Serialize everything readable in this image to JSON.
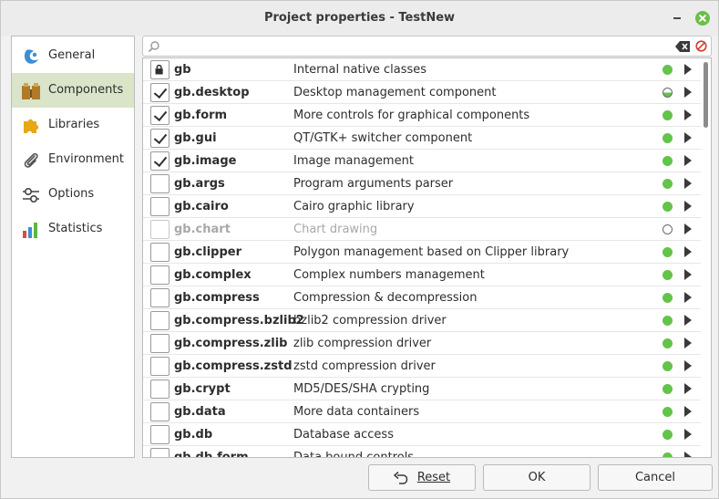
{
  "window": {
    "title": "Project properties - TestNew"
  },
  "sidebar": {
    "items": [
      {
        "label": "General",
        "icon": "gambas-icon",
        "active": false
      },
      {
        "label": "Components",
        "icon": "components-icon",
        "active": true
      },
      {
        "label": "Libraries",
        "icon": "puzzle-icon",
        "active": false
      },
      {
        "label": "Environment",
        "icon": "paperclip-icon",
        "active": false
      },
      {
        "label": "Options",
        "icon": "toggle-icon",
        "active": false
      },
      {
        "label": "Statistics",
        "icon": "bar-chart-icon",
        "active": false
      }
    ]
  },
  "search": {
    "value": "",
    "placeholder": ""
  },
  "components": [
    {
      "name": "gb",
      "description": "Internal native classes",
      "state": "locked",
      "status": "stable"
    },
    {
      "name": "gb.desktop",
      "description": "Desktop management component",
      "state": "checked",
      "status": "half"
    },
    {
      "name": "gb.form",
      "description": "More controls for graphical components",
      "state": "checked",
      "status": "stable"
    },
    {
      "name": "gb.gui",
      "description": "QT/GTK+ switcher component",
      "state": "checked",
      "status": "stable"
    },
    {
      "name": "gb.image",
      "description": "Image management",
      "state": "checked",
      "status": "stable"
    },
    {
      "name": "gb.args",
      "description": "Program arguments parser",
      "state": "unchecked",
      "status": "stable"
    },
    {
      "name": "gb.cairo",
      "description": "Cairo graphic library",
      "state": "unchecked",
      "status": "stable"
    },
    {
      "name": "gb.chart",
      "description": "Chart drawing",
      "state": "disabled",
      "status": "none"
    },
    {
      "name": "gb.clipper",
      "description": "Polygon management based on Clipper library",
      "state": "unchecked",
      "status": "stable"
    },
    {
      "name": "gb.complex",
      "description": "Complex numbers management",
      "state": "unchecked",
      "status": "stable"
    },
    {
      "name": "gb.compress",
      "description": "Compression & decompression",
      "state": "unchecked",
      "status": "stable"
    },
    {
      "name": "gb.compress.bzlib2",
      "description": "bzlib2 compression driver",
      "state": "unchecked",
      "status": "stable"
    },
    {
      "name": "gb.compress.zlib",
      "description": "zlib compression driver",
      "state": "unchecked",
      "status": "stable"
    },
    {
      "name": "gb.compress.zstd",
      "description": "zstd compression driver",
      "state": "unchecked",
      "status": "stable"
    },
    {
      "name": "gb.crypt",
      "description": "MD5/DES/SHA crypting",
      "state": "unchecked",
      "status": "stable"
    },
    {
      "name": "gb.data",
      "description": "More data containers",
      "state": "unchecked",
      "status": "stable"
    },
    {
      "name": "gb.db",
      "description": "Database access",
      "state": "unchecked",
      "status": "stable"
    },
    {
      "name": "gb.db.form",
      "description": "Data bound controls",
      "state": "unchecked",
      "status": "stable"
    }
  ],
  "buttons": {
    "reset_label": "Reset",
    "ok_label": "OK",
    "cancel_label": "Cancel"
  },
  "colors": {
    "active_sidebar": "#d9e4c9",
    "status_green": "#63c34a",
    "close_button": "#6bbf49"
  }
}
